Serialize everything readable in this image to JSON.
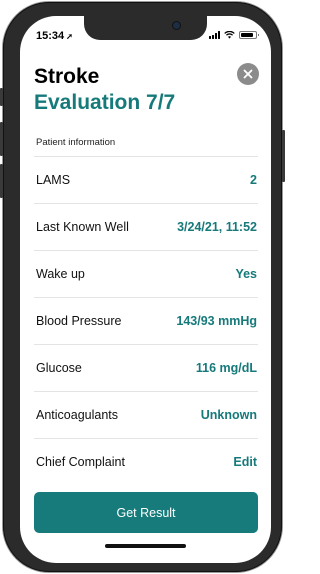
{
  "status_bar": {
    "time": "15:34",
    "location_glyph": "➚"
  },
  "header": {
    "title": "Stroke",
    "subtitle": "Evaluation 7/7",
    "close_icon": "close-icon"
  },
  "section": {
    "label": "Patient information"
  },
  "rows": [
    {
      "label": "LAMS",
      "value": "2"
    },
    {
      "label": "Last Known Well",
      "value": "3/24/21, 11:52"
    },
    {
      "label": "Wake up",
      "value": "Yes"
    },
    {
      "label": "Blood Pressure",
      "value": "143/93 mmHg"
    },
    {
      "label": "Glucose",
      "value": "116 mg/dL"
    },
    {
      "label": "Anticoagulants",
      "value": "Unknown"
    },
    {
      "label": "Chief Complaint",
      "value": "Edit"
    }
  ],
  "cta": {
    "label": "Get Result"
  },
  "colors": {
    "accent": "#16797a",
    "button": "#177b7b",
    "close_bg": "#8b8b8b"
  }
}
